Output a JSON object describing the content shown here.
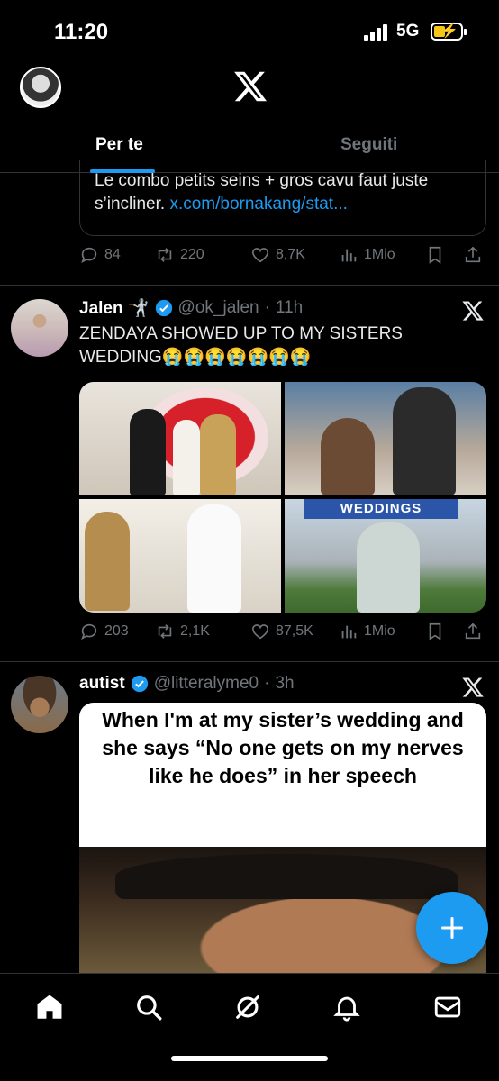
{
  "status_bar": {
    "time": "11:20",
    "network": "5G"
  },
  "header": {
    "tabs": [
      {
        "label": "Per te",
        "active": true
      },
      {
        "label": "Seguiti",
        "active": false
      }
    ]
  },
  "tweets": [
    {
      "quote_text": "Le combo petits seins + gros cavu faut juste s’incliner.",
      "quote_link": "x.com/bornakang/stat...",
      "stats": {
        "replies": "84",
        "reposts": "220",
        "likes": "8,7K",
        "views": "1Mio"
      }
    },
    {
      "name": "Jalen",
      "name_emoji": "🤺",
      "handle": "@ok_jalen",
      "time": "11h",
      "text": "ZENDAYA SHOWED UP TO MY SISTERS WEDDING😭😭😭😭😭😭😭",
      "photo_sign": "WEDDINGS",
      "stats": {
        "replies": "203",
        "reposts": "2,1K",
        "likes": "87,5K",
        "views": "1Mio"
      }
    },
    {
      "name": "autist",
      "handle": "@litteralyme0",
      "time": "3h",
      "meme_text": "When I'm at my sister’s wedding and she says “No one gets on my nerves like he does” in her speech"
    }
  ],
  "sep": "·",
  "colors": {
    "accent": "#1d9bf0",
    "background": "#000000",
    "muted": "#71767b",
    "divider": "#2f3336"
  },
  "icons": [
    "x-logo-icon",
    "reply-icon",
    "repost-icon",
    "like-icon",
    "views-icon",
    "bookmark-icon",
    "share-icon",
    "verified-icon",
    "home-icon",
    "search-icon",
    "grok-icon",
    "notifications-icon",
    "messages-icon",
    "compose-icon"
  ]
}
